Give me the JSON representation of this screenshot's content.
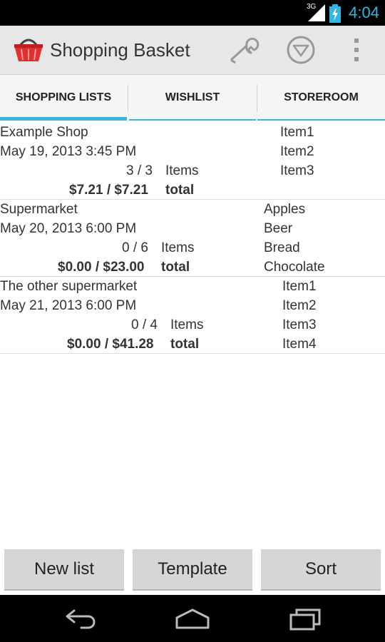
{
  "status_bar": {
    "network": "3G",
    "time": "4:04"
  },
  "action_bar": {
    "title": "Shopping Basket"
  },
  "tabs": [
    {
      "label": "SHOPPING LISTS",
      "active": true
    },
    {
      "label": "WISHLIST",
      "active": false
    },
    {
      "label": "STOREROOM",
      "active": false
    }
  ],
  "lists": [
    {
      "name": "Example Shop",
      "date": "May 19, 2013 3:45 PM",
      "count": "3 / 3",
      "items_label": "Items",
      "price": "$7.21 / $7.21",
      "total_label": "total",
      "items": [
        "Item1",
        "Item2",
        "Item3"
      ]
    },
    {
      "name": "Supermarket",
      "date": "May 20, 2013 6:00 PM",
      "count": "0 / 6",
      "items_label": "Items",
      "price": "$0.00 / $23.00",
      "total_label": "total",
      "items": [
        "Apples",
        "Beer",
        "Bread",
        "Chocolate"
      ]
    },
    {
      "name": "The other supermarket",
      "date": "May 21, 2013 6:00 PM",
      "count": "0 / 4",
      "items_label": "Items",
      "price": "$0.00 / $41.28",
      "total_label": "total",
      "items": [
        "Item1",
        "Item2",
        "Item3",
        "Item4"
      ]
    }
  ],
  "buttons": {
    "new_list": "New list",
    "template": "Template",
    "sort": "Sort"
  },
  "colors": {
    "accent": "#33b5e5",
    "basket": "#e03030"
  }
}
